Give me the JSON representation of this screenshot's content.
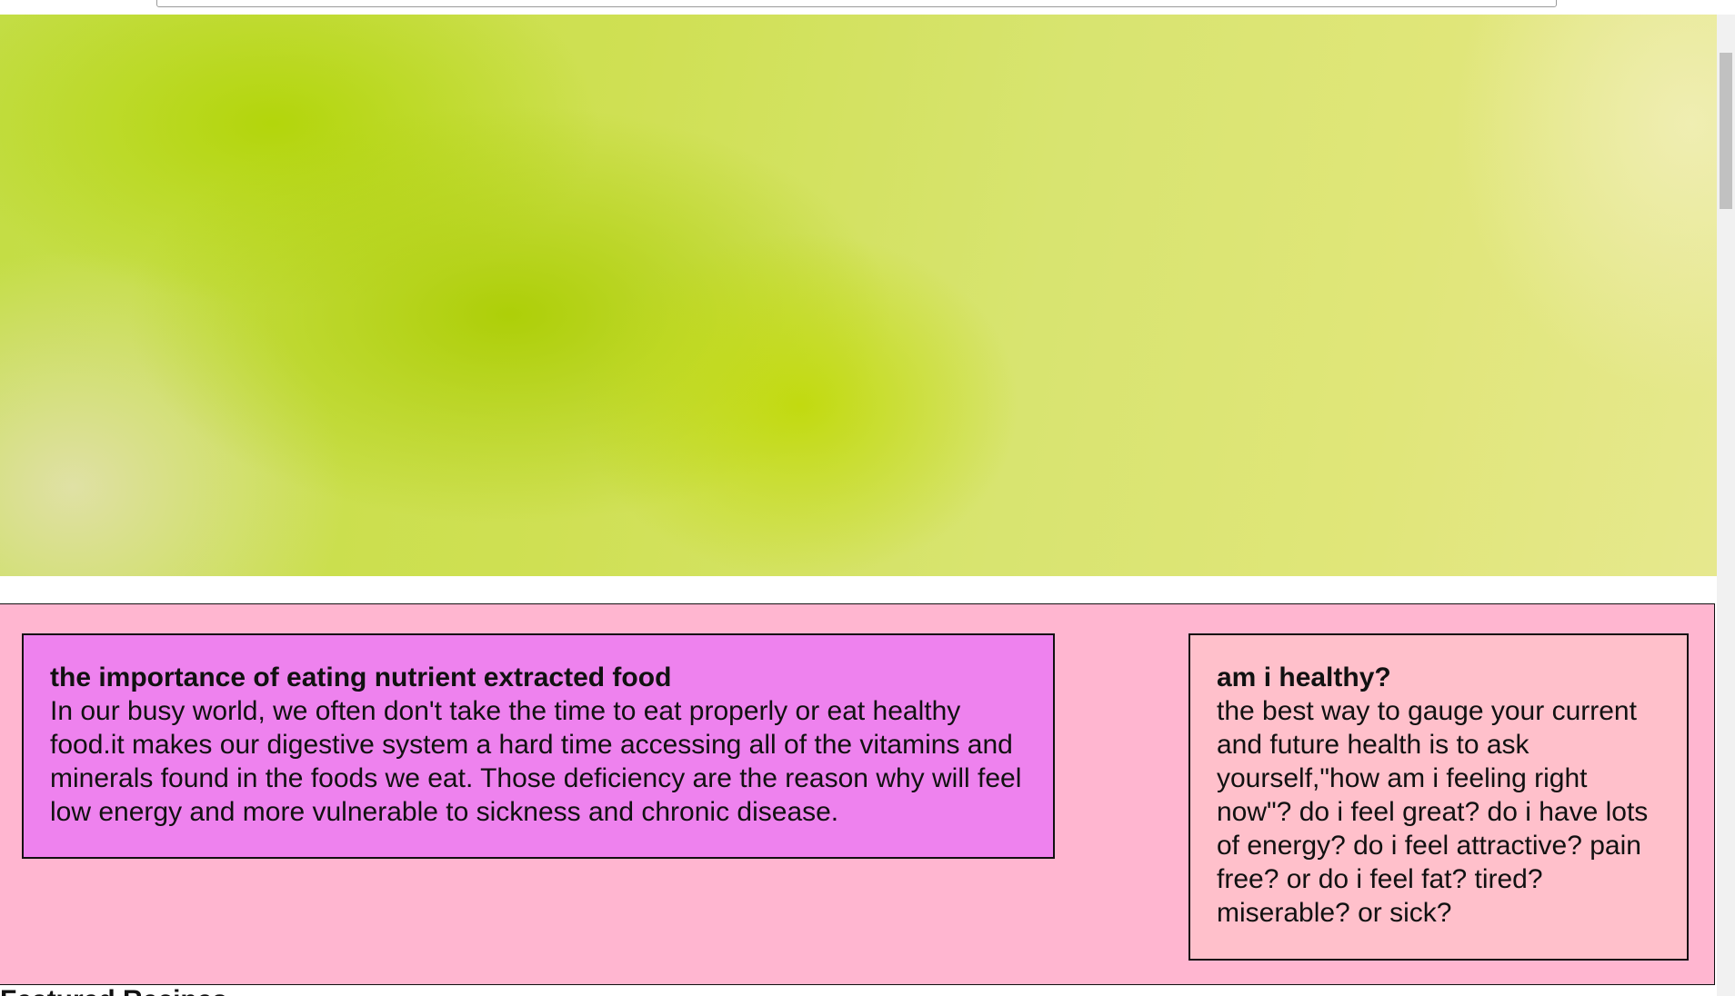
{
  "browser": {
    "url": ""
  },
  "hero": {
    "image": "blurred-green-yellow-background"
  },
  "articles": [
    {
      "title": "the importance of eating nutrient extracted food",
      "body": "In our busy world, we often don't take the time to eat properly or eat healthy food.it makes our digestive system a hard time accessing all of the vitamins and minerals found in the foods we eat. Those deficiency are the reason why will feel low energy and more vulnerable to sickness and chronic disease.",
      "background": "#ee82ee"
    },
    {
      "title": "am i healthy?",
      "body": "the best way to gauge your current and future health is to ask yourself,\"how am i feeling right now\"? do i feel great? do i have lots of energy? do i feel attractive? pain free? or do i feel fat? tired? miserable? or sick?",
      "background": "#ffc0cb"
    }
  ],
  "section": {
    "background": "#ffb6d0",
    "next_heading": "Featured Recipes"
  }
}
